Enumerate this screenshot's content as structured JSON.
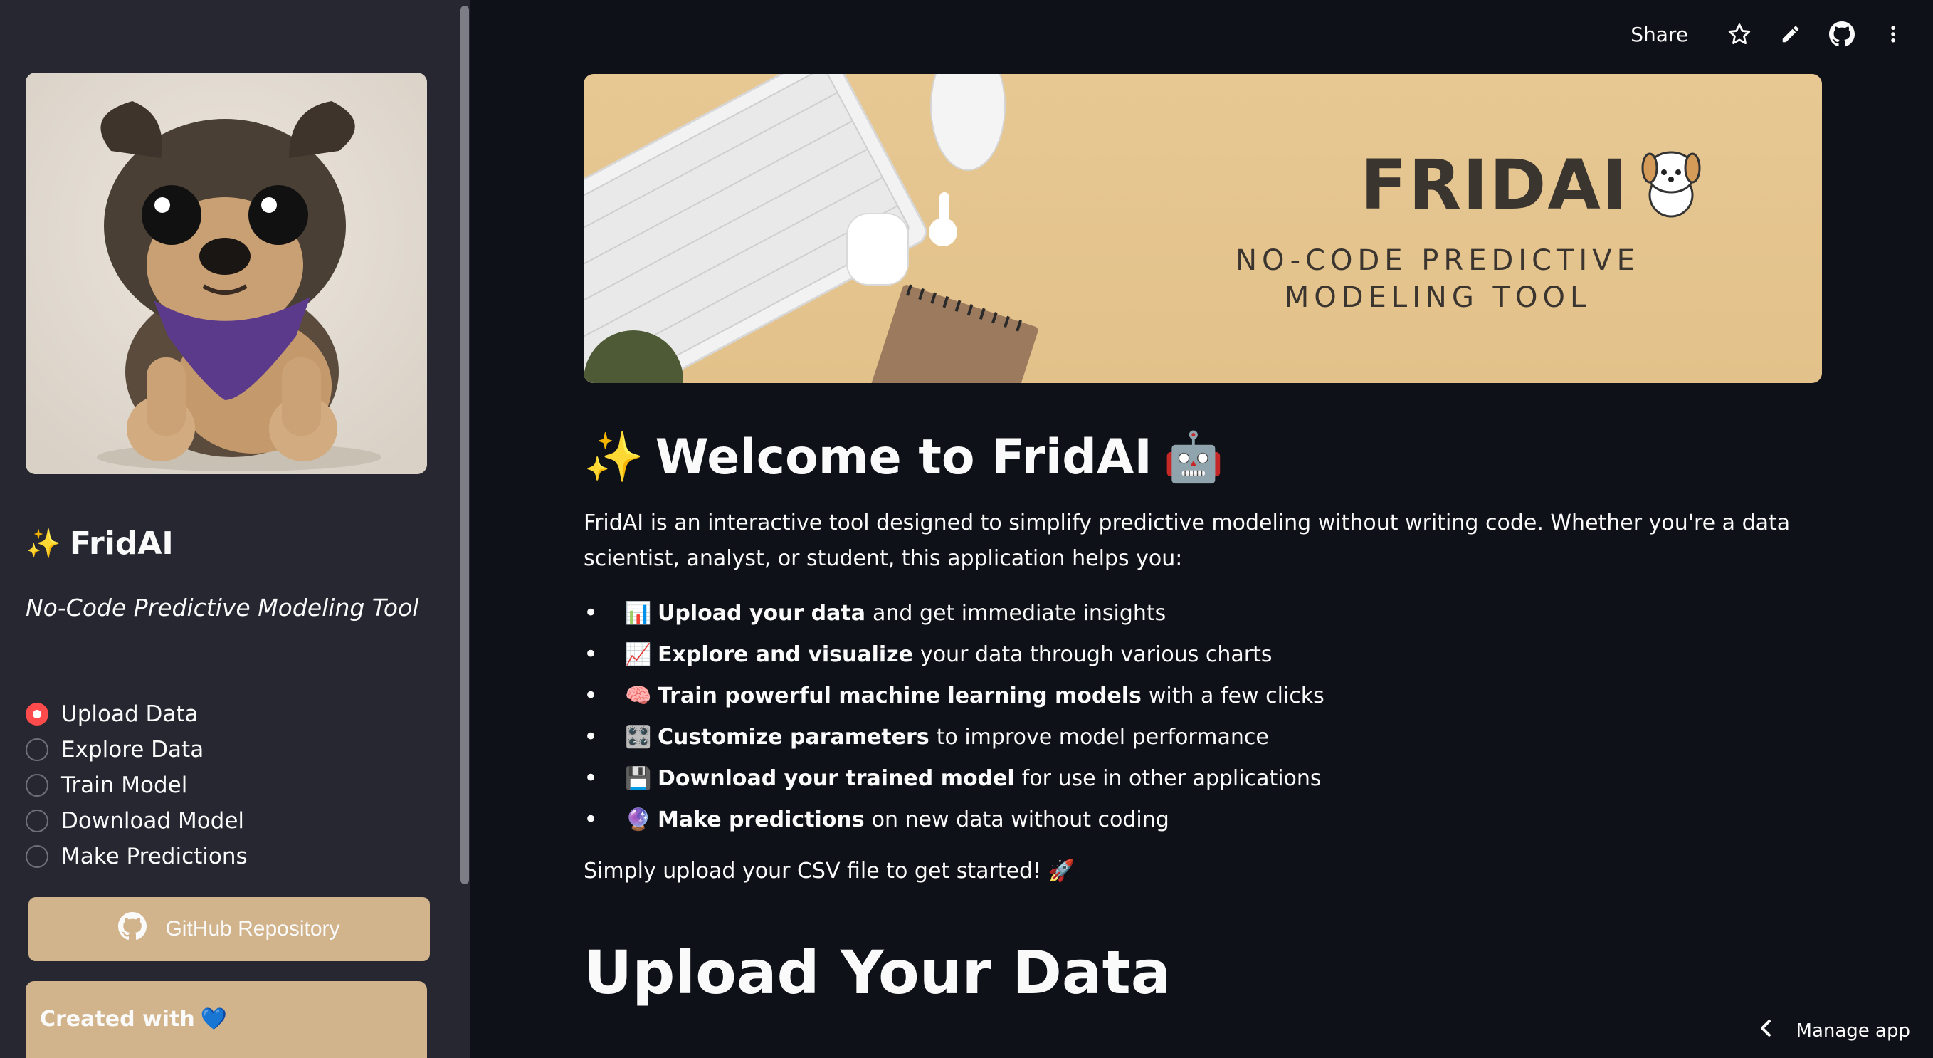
{
  "toolbar": {
    "share_label": "Share",
    "icons": [
      "star-icon",
      "pencil-icon",
      "github-icon",
      "more-vert-icon"
    ]
  },
  "sidebar": {
    "brand_title": "FridAI",
    "brand_subtitle": "No-Code Predictive Modeling Tool",
    "nav": [
      {
        "label": "Upload Data",
        "selected": true
      },
      {
        "label": "Explore Data",
        "selected": false
      },
      {
        "label": "Train Model",
        "selected": false
      },
      {
        "label": "Download Model",
        "selected": false
      },
      {
        "label": "Make Predictions",
        "selected": false
      }
    ],
    "github_button": "GitHub Repository",
    "created_with": "Created with"
  },
  "banner": {
    "title": "FRIDAI",
    "subtitle": "NO-CODE PREDICTIVE MODELING TOOL"
  },
  "main": {
    "welcome_heading": "Welcome to FridAI",
    "intro": "FridAI is an interactive tool designed to simplify predictive modeling without writing code. Whether you're a data scientist, analyst, or student, this application helps you:",
    "features": [
      {
        "emoji": "📊",
        "bold": "Upload your data",
        "rest": "and get immediate insights"
      },
      {
        "emoji": "📈",
        "bold": "Explore and visualize",
        "rest": "your data through various charts"
      },
      {
        "emoji": "🧠",
        "bold": "Train powerful machine learning models",
        "rest": "with a few clicks"
      },
      {
        "emoji": "🎛️",
        "bold": "Customize parameters",
        "rest": "to improve model performance"
      },
      {
        "emoji": "💾",
        "bold": "Download your trained model",
        "rest": "for use in other applications"
      },
      {
        "emoji": "🔮",
        "bold": "Make predictions",
        "rest": "on new data without coding"
      }
    ],
    "cta": "Simply upload your CSV file to get started! 🚀",
    "upload_heading": "Upload Your Data"
  },
  "footer": {
    "manage_app": "Manage app"
  },
  "colors": {
    "background": "#0e1117",
    "sidebar": "#262730",
    "accent_tan": "#d2b48c",
    "radio_selected": "#ff4b4b"
  }
}
